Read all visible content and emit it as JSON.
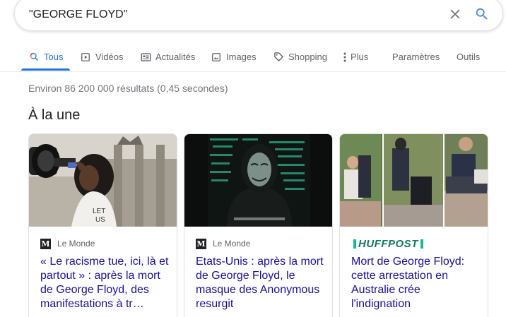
{
  "search": {
    "query": "\"GEORGE FLOYD\""
  },
  "tabs": [
    {
      "label": "Tous",
      "icon": "search-icon",
      "active": true
    },
    {
      "label": "Vidéos",
      "icon": "video-icon"
    },
    {
      "label": "Actualités",
      "icon": "news-icon"
    },
    {
      "label": "Images",
      "icon": "image-icon"
    },
    {
      "label": "Shopping",
      "icon": "tag-icon"
    },
    {
      "label": "Plus",
      "icon": "more-vert-icon"
    },
    {
      "label": "Paramètres"
    },
    {
      "label": "Outils"
    }
  ],
  "result_stats": "Environ 86 200 000 résultats (0,45 secondes)",
  "top_stories": {
    "title": "À la une",
    "cards": [
      {
        "source": "Le Monde",
        "headline": "« Le racisme tue, ici, là et partout » : après la mort de George Floyd, des manifestations à tr…"
      },
      {
        "source": "Le Monde",
        "headline": "Etats-Unis : après la mort de George Floyd, le masque des Anonymous resurgit"
      },
      {
        "source": "HUFFPOST",
        "headline": "Mort de George Floyd: cette arrestation en Australie crée l'indignation"
      }
    ]
  },
  "colors": {
    "accent": "#1a73e8",
    "link": "#1a0dab",
    "huffpost": "#0dbe98"
  }
}
